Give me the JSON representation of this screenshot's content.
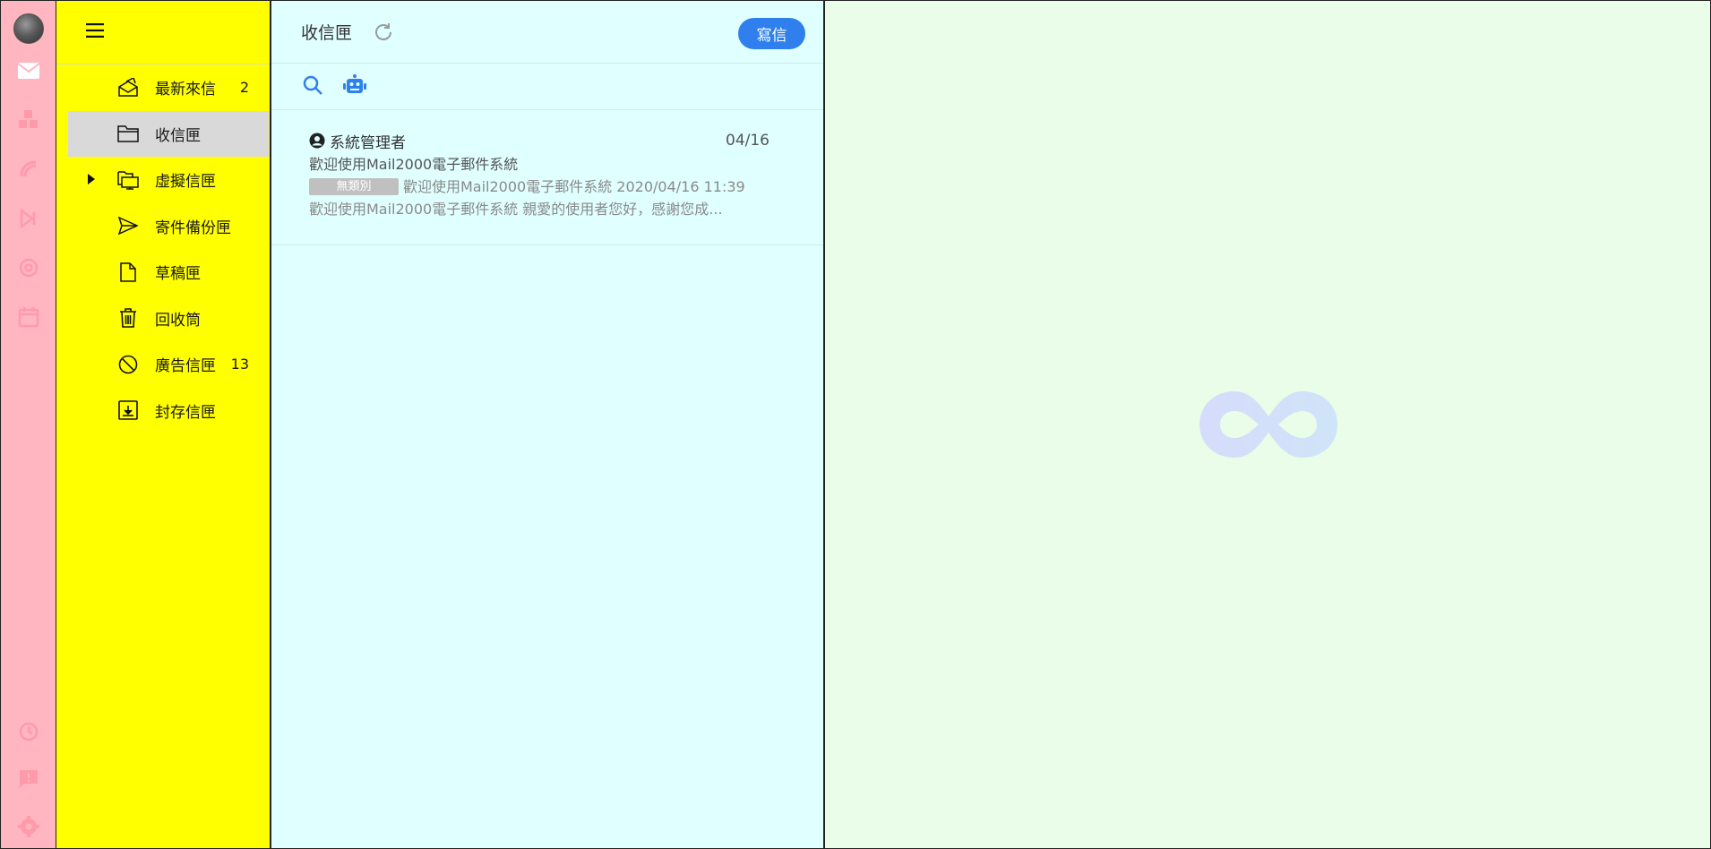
{
  "rail": {
    "icons_top": [
      "mail-icon",
      "apps-icon",
      "headset-icon",
      "forward-icon",
      "at-sign-icon",
      "calendar-icon"
    ],
    "icons_bottom": [
      "history-icon",
      "feedback-icon",
      "settings-icon"
    ]
  },
  "folders": {
    "items": [
      {
        "label": "最新來信",
        "count": "2",
        "icon": "new-mail-icon"
      },
      {
        "label": "收信匣",
        "count": "",
        "icon": "folder-icon"
      },
      {
        "label": "虛擬信匣",
        "count": "",
        "icon": "virtual-folder-icon"
      },
      {
        "label": "寄件備份匣",
        "count": "",
        "icon": "send-icon"
      },
      {
        "label": "草稿匣",
        "count": "",
        "icon": "draft-icon"
      },
      {
        "label": "回收筒",
        "count": "",
        "icon": "trash-icon"
      },
      {
        "label": "廣告信匣",
        "count": "13",
        "icon": "block-icon"
      },
      {
        "label": "封存信匣",
        "count": "",
        "icon": "archive-icon"
      }
    ]
  },
  "list": {
    "title": "收信匣",
    "compose_label": "寫信",
    "mails": [
      {
        "from": "系統管理者",
        "date": "04/16",
        "subject": "歡迎使用Mail2000電子郵件系統",
        "badge": "無類別",
        "preview_line1": "歡迎使用Mail2000電子郵件系統 2020/04/16 11:39",
        "preview_line2": "歡迎使用Mail2000電子郵件系統 親愛的使用者您好，感謝您成..."
      }
    ]
  },
  "colors": {
    "rail_bg": "#ffb6c1",
    "folders_bg": "#ffff00",
    "list_bg": "#e0ffff",
    "pane_bg": "#e9fde9",
    "accent": "#2f80ed",
    "active_folder": "#d9d9d9"
  }
}
